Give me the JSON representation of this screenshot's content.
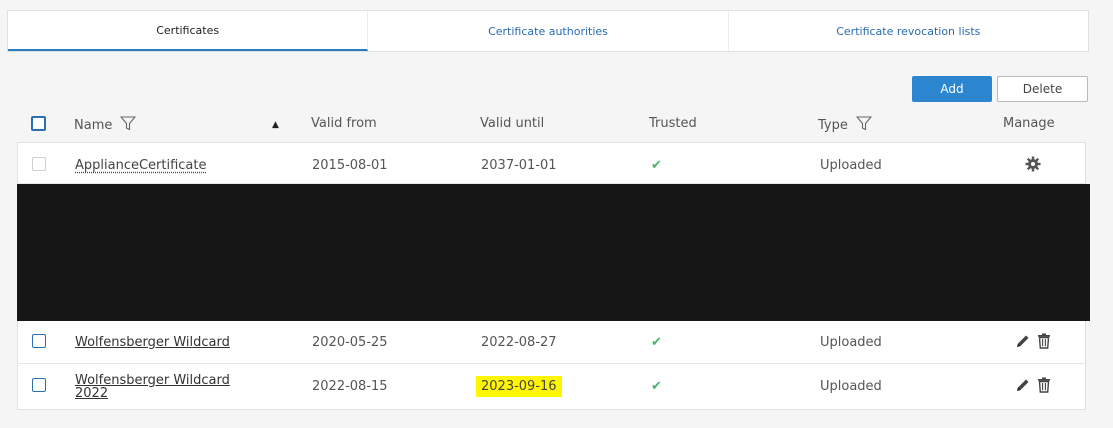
{
  "tabs": [
    {
      "label": "Certificates",
      "active": true
    },
    {
      "label": "Certificate authorities",
      "active": false
    },
    {
      "label": "Certificate revocation lists",
      "active": false
    }
  ],
  "toolbar": {
    "add_label": "Add",
    "delete_label": "Delete"
  },
  "columns": {
    "name": "Name",
    "valid_from": "Valid from",
    "valid_until": "Valid until",
    "trusted": "Trusted",
    "type": "Type",
    "manage": "Manage"
  },
  "rows": [
    {
      "name": "ApplianceCertificate",
      "valid_from": "2015-08-01",
      "valid_until": "2037-01-01",
      "trusted": "✔",
      "type": "Uploaded",
      "manage": "gear-icon",
      "selectable": false
    },
    {
      "name": "Wolfensberger Wildcard",
      "valid_from": "2020-05-25",
      "valid_until": "2022-08-27",
      "trusted": "✔",
      "type": "Uploaded",
      "manage": "edit-delete-icons",
      "selectable": true
    },
    {
      "name_line1": "Wolfensberger Wildcard",
      "name_line2": "2022",
      "valid_from": "2022-08-15",
      "valid_until": "2023-09-16",
      "trusted": "✔",
      "type": "Uploaded",
      "manage": "edit-delete-icons",
      "selectable": true,
      "valid_until_highlight": "#fff600"
    }
  ],
  "colors": {
    "accent": "#2b86cf",
    "check": "#47b36e",
    "highlight": "#fff600",
    "redaction": "#161616"
  }
}
